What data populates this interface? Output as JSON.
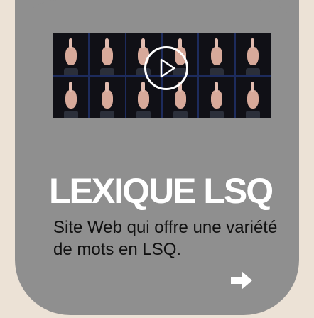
{
  "card": {
    "title": "LEXIQUE LSQ",
    "description": "Site Web qui offre une variété de mots en LSQ."
  },
  "icons": {
    "play": "play-circle-icon",
    "arrow": "arrow-right-icon"
  },
  "colors": {
    "background": "#ece2d6",
    "card": "#8f8f8f",
    "title": "#ffffff",
    "text": "#111111",
    "thumb": "#0c0c10"
  }
}
